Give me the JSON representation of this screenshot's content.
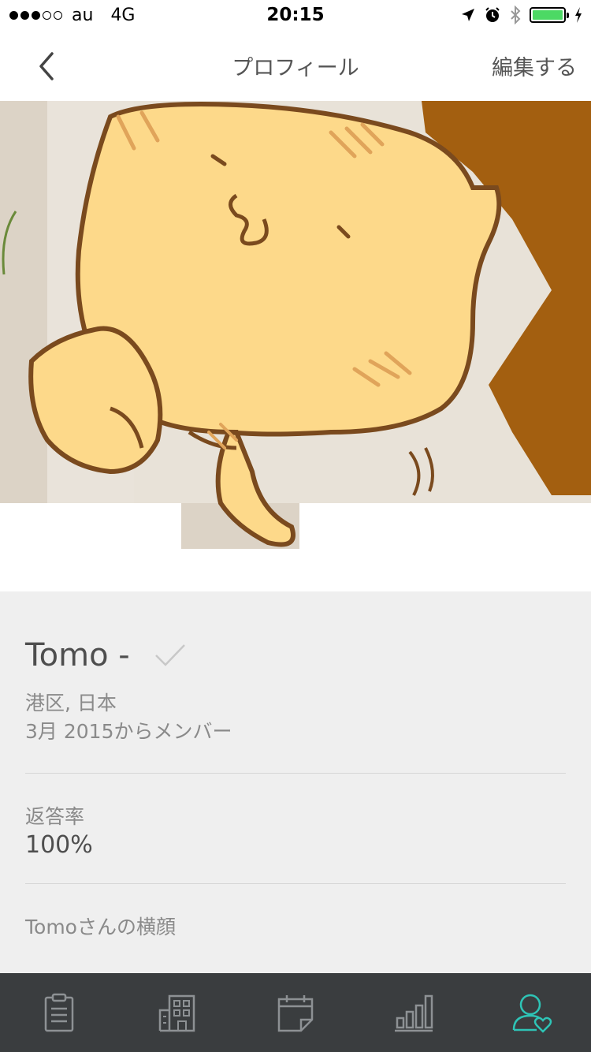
{
  "status_bar": {
    "carrier": "au",
    "network": "4G",
    "time": "20:15"
  },
  "nav": {
    "title": "プロフィール",
    "edit_label": "編集する"
  },
  "profile": {
    "name": "Tomo -",
    "location": "港区, 日本",
    "member_since": "3月 2015からメンバー",
    "response_rate_label": "返答率",
    "response_rate_value": "100%",
    "profile_link": "Tomoさんの横顔"
  },
  "tab_bar": {
    "items": [
      {
        "icon": "clipboard-icon"
      },
      {
        "icon": "building-icon"
      },
      {
        "icon": "calendar-icon"
      },
      {
        "icon": "bar-chart-icon"
      },
      {
        "icon": "profile-heart-icon",
        "active": true
      }
    ],
    "active_color": "#2ec4b6",
    "inactive_color": "#8d9194"
  },
  "colors": {
    "background": "#efefef",
    "tab_bar": "#3a3d3f"
  }
}
